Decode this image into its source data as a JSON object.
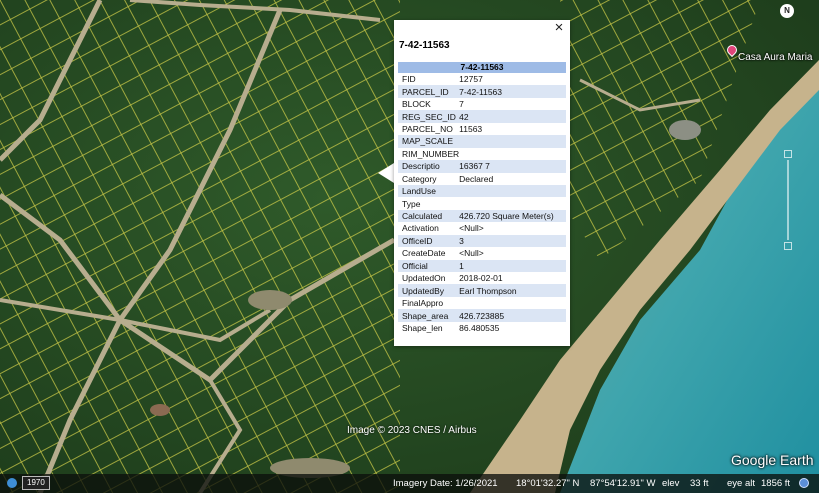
{
  "map": {
    "place_label": "Casa Aura Maria",
    "compass_label": "N",
    "watermark": "Image © 2023 CNES / Airbus",
    "logo": "Google Earth"
  },
  "popup": {
    "title": "7-42-11563",
    "table_header": "7-42-11563",
    "close_label": "×",
    "rows": [
      {
        "key": "FID",
        "value": "12757"
      },
      {
        "key": "PARCEL_ID",
        "value": "7-42-11563"
      },
      {
        "key": "BLOCK",
        "value": "7"
      },
      {
        "key": "REG_SEC_ID",
        "value": "42"
      },
      {
        "key": "PARCEL_NO",
        "value": "11563"
      },
      {
        "key": "MAP_SCALE",
        "value": ""
      },
      {
        "key": "RIM_NUMBER",
        "value": ""
      },
      {
        "key": "Descriptio",
        "value": "16367 7"
      },
      {
        "key": "Category",
        "value": "Declared"
      },
      {
        "key": "LandUse",
        "value": ""
      },
      {
        "key": "Type",
        "value": ""
      },
      {
        "key": "Calculated",
        "value": "426.720 Square Meter(s)"
      },
      {
        "key": "Activation",
        "value": "<Null>"
      },
      {
        "key": "OfficeID",
        "value": "3"
      },
      {
        "key": "CreateDate",
        "value": "<Null>"
      },
      {
        "key": "Official",
        "value": "1"
      },
      {
        "key": "UpdatedOn",
        "value": "2018-02-01"
      },
      {
        "key": "UpdatedBy",
        "value": "Earl Thompson"
      },
      {
        "key": "FinalAppro",
        "value": ""
      },
      {
        "key": "Shape_area",
        "value": "426.723885"
      },
      {
        "key": "Shape_len",
        "value": "86.480535"
      }
    ]
  },
  "statusbar": {
    "year": "1970",
    "imagery_date": "Imagery Date: 1/26/2021",
    "lat": "18°01'32.27\" N",
    "lon": "87°54'12.91\" W",
    "elev_label": "elev",
    "elev_value": "33 ft",
    "eye_alt_label": "eye alt",
    "eye_alt_value": "1856 ft"
  },
  "colors": {
    "table_header": "#9ebbe6",
    "row_alt": "#dbe5f4",
    "sea": "#3fa9b0",
    "sand": "#c9b89a"
  }
}
